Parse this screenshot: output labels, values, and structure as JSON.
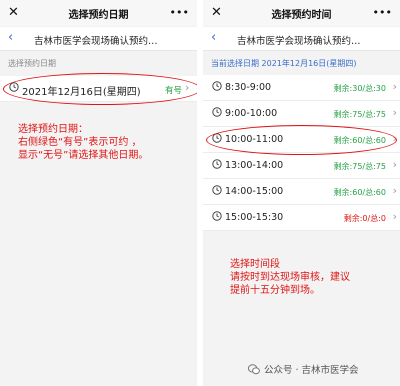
{
  "left": {
    "title": "选择预约日期",
    "nav_title": "吉林市医学会现场确认预约…",
    "section_label": "选择预约日期",
    "date": "2021年12月16日(星期四)",
    "availability": "有号",
    "annotation": [
      "选择预约日期：",
      "右侧绿色“有号”表示可约 ，",
      "显示“无号”请选择其他日期。"
    ]
  },
  "right": {
    "title": "选择预约时间",
    "nav_title": "吉林市医学会现场确认预约…",
    "current_date": "当前选择日期 2021年12月16日(星期四)",
    "slots": [
      {
        "time": "8:30-9:00",
        "quota": "剩余:30/总:30",
        "status": "open"
      },
      {
        "time": "9:00-10:00",
        "quota": "剩余:75/总:75",
        "status": "open"
      },
      {
        "time": "10:00-11:00",
        "quota": "剩余:60/总:60",
        "status": "open"
      },
      {
        "time": "13:00-14:00",
        "quota": "剩余:75/总:75",
        "status": "open"
      },
      {
        "time": "14:00-15:00",
        "quota": "剩余:60/总:60",
        "status": "open"
      },
      {
        "time": "15:00-15:30",
        "quota": "剩余:0/总:0",
        "status": "full"
      }
    ],
    "annotation": [
      "选择时间段",
      "请按时到达现场审核，建议",
      "提前十五分钟到场。"
    ]
  },
  "watermark": "公众号 · 吉林市医学会",
  "colors": {
    "accent": "#3b6cc9",
    "available": "#25a244",
    "alert": "#e01414"
  }
}
